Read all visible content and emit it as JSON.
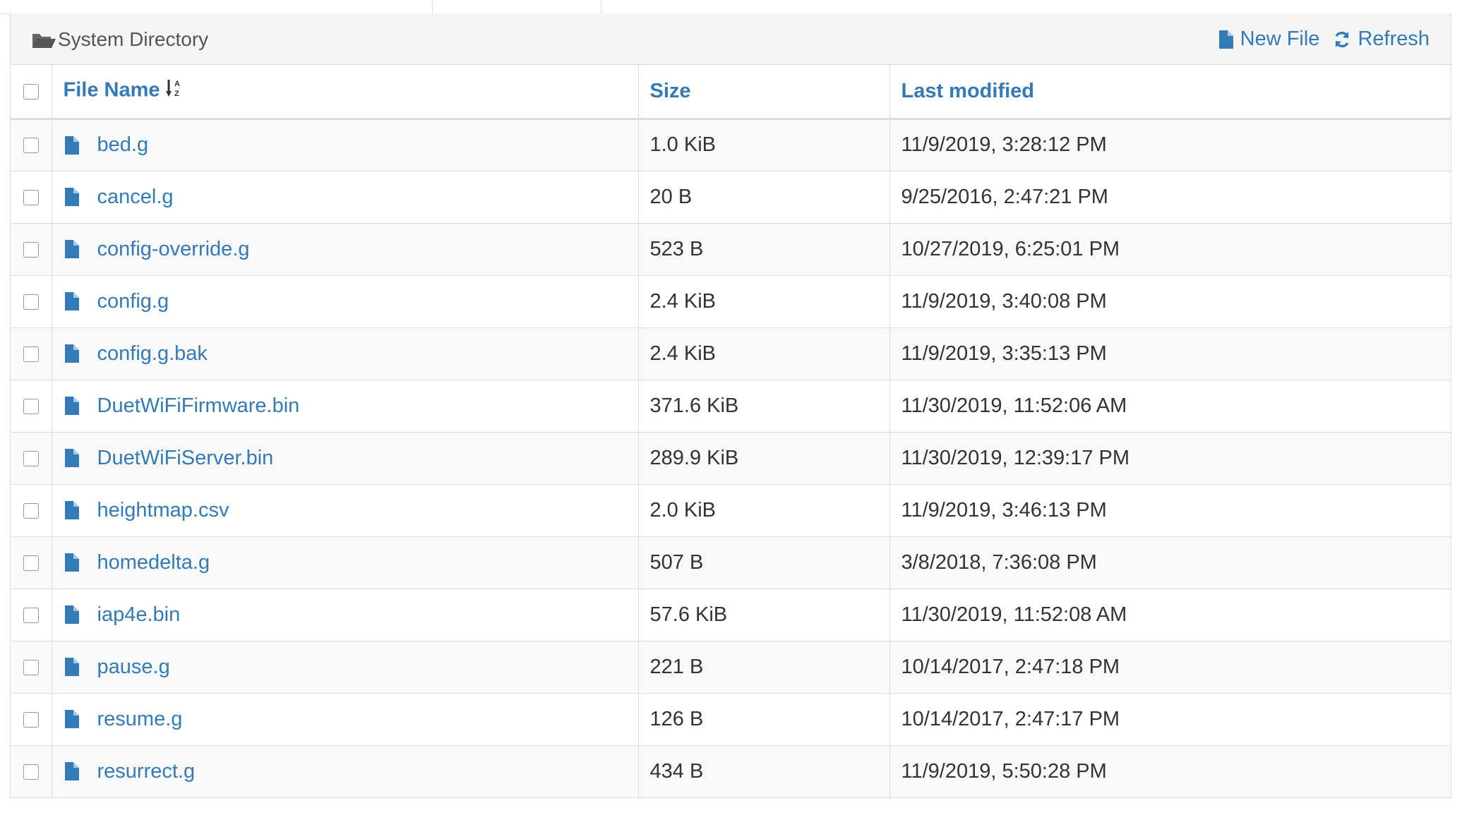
{
  "panel": {
    "title": "System Directory",
    "folder_icon": "folder-open-icon",
    "actions": {
      "new_file_label": "New File",
      "new_file_icon": "file-icon",
      "refresh_label": "Refresh",
      "refresh_icon": "refresh-icon"
    }
  },
  "table": {
    "columns": {
      "name": "File Name",
      "size": "Size",
      "modified": "Last modified"
    },
    "sort_icon": "sort-alpha-asc-icon",
    "rows": [
      {
        "name": "bed.g",
        "size": "1.0 KiB",
        "modified": "11/9/2019, 3:28:12 PM"
      },
      {
        "name": "cancel.g",
        "size": "20 B",
        "modified": "9/25/2016, 2:47:21 PM"
      },
      {
        "name": "config-override.g",
        "size": "523 B",
        "modified": "10/27/2019, 6:25:01 PM"
      },
      {
        "name": "config.g",
        "size": "2.4 KiB",
        "modified": "11/9/2019, 3:40:08 PM"
      },
      {
        "name": "config.g.bak",
        "size": "2.4 KiB",
        "modified": "11/9/2019, 3:35:13 PM"
      },
      {
        "name": "DuetWiFiFirmware.bin",
        "size": "371.6 KiB",
        "modified": "11/30/2019, 11:52:06 AM"
      },
      {
        "name": "DuetWiFiServer.bin",
        "size": "289.9 KiB",
        "modified": "11/30/2019, 12:39:17 PM"
      },
      {
        "name": "heightmap.csv",
        "size": "2.0 KiB",
        "modified": "11/9/2019, 3:46:13 PM"
      },
      {
        "name": "homedelta.g",
        "size": "507 B",
        "modified": "3/8/2018, 7:36:08 PM"
      },
      {
        "name": "iap4e.bin",
        "size": "57.6 KiB",
        "modified": "11/30/2019, 11:52:08 AM"
      },
      {
        "name": "pause.g",
        "size": "221 B",
        "modified": "10/14/2017, 2:47:18 PM"
      },
      {
        "name": "resume.g",
        "size": "126 B",
        "modified": "10/14/2017, 2:47:17 PM"
      },
      {
        "name": "resurrect.g",
        "size": "434 B",
        "modified": "11/9/2019, 5:50:28 PM"
      }
    ]
  },
  "colors": {
    "link": "#337ab7",
    "heading_bg": "#f5f5f5",
    "border": "#dddddd",
    "stripe": "#f9f9f9"
  }
}
